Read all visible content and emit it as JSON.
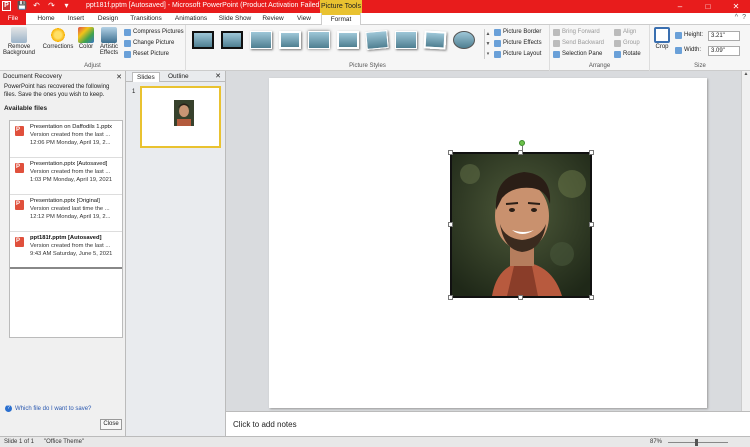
{
  "window": {
    "title": "ppt181f.pptm [Autosaved] - Microsoft PowerPoint (Product Activation Failed)",
    "context_tab_header": "Picture Tools",
    "minimize": "–",
    "maximize": "□",
    "close": "✕"
  },
  "quick_access": {
    "logo": "P",
    "save": "💾",
    "undo": "↶",
    "redo": "↷",
    "customize": "▾"
  },
  "tabs": [
    "File",
    "Home",
    "Insert",
    "Design",
    "Transitions",
    "Animations",
    "Slide Show",
    "Review",
    "View",
    "Format"
  ],
  "ribbon": {
    "adjust": {
      "label": "Adjust",
      "remove_background": "Remove Background",
      "corrections": "Corrections",
      "color": "Color",
      "artistic_effects": "Artistic Effects",
      "compress_pictures": "Compress Pictures",
      "change_picture": "Change Picture",
      "reset_picture": "Reset Picture"
    },
    "picture_styles": {
      "label": "Picture Styles",
      "picture_border": "Picture Border",
      "picture_effects": "Picture Effects",
      "picture_layout": "Picture Layout"
    },
    "arrange": {
      "label": "Arrange",
      "bring_forward": "Bring Forward",
      "send_backward": "Send Backward",
      "selection_pane": "Selection Pane",
      "align": "Align",
      "group": "Group",
      "rotate": "Rotate"
    },
    "size": {
      "label": "Size",
      "crop": "Crop",
      "height_label": "Height:",
      "height_value": "3.21\"",
      "width_label": "Width:",
      "width_value": "3.09\""
    }
  },
  "recovery": {
    "title": "Document Recovery",
    "message": "PowerPoint has recovered the following files. Save the ones you wish to keep.",
    "available_label": "Available files",
    "files": [
      {
        "name": "Presentation on Daffodils 1.pptx",
        "desc": "Version created from the last ...",
        "date": "12:06 PM Monday, April 19, 2..."
      },
      {
        "name": "Presentation.pptx  [Autosaved]",
        "desc": "Version created from the last ...",
        "date": "1:03 PM Monday, April 19, 2021"
      },
      {
        "name": "Presentation.pptx  [Original]",
        "desc": "Version created last time the ...",
        "date": "12:12 PM Monday, April 19, 2..."
      },
      {
        "name": "ppt181f.pptm  [Autosaved]",
        "desc": "Version created from the last ...",
        "date": "9:43 AM Saturday, June 5, 2021"
      }
    ],
    "help_link": "Which file do I want to save?",
    "close_button": "Close"
  },
  "slides_panel": {
    "tab_slides": "Slides",
    "tab_outline": "Outline",
    "slide_number": "1"
  },
  "notes_placeholder": "Click to add notes",
  "status": {
    "slide_info": "Slide 1 of 1",
    "theme": "\"Office Theme\"",
    "zoom": "87%"
  }
}
